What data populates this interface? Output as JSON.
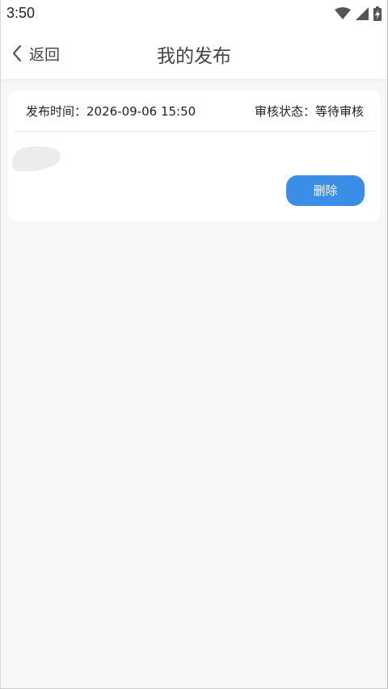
{
  "status_bar": {
    "time": "3:50",
    "icons": [
      "wifi-icon",
      "signal-icon",
      "battery-charging-icon"
    ]
  },
  "nav": {
    "back_label": "返回",
    "title": "我的发布",
    "back_icon": "chevron-left-icon"
  },
  "post": {
    "publish_time": "发布时间：2026-09-06 15:50",
    "review_status": "审核状态：等待审核",
    "delete_label": "删除",
    "thumbnail_icon": "image-placeholder-icon"
  },
  "colors": {
    "accent": "#3a8ee6",
    "background": "#f7f7f9",
    "card": "#ffffff"
  }
}
